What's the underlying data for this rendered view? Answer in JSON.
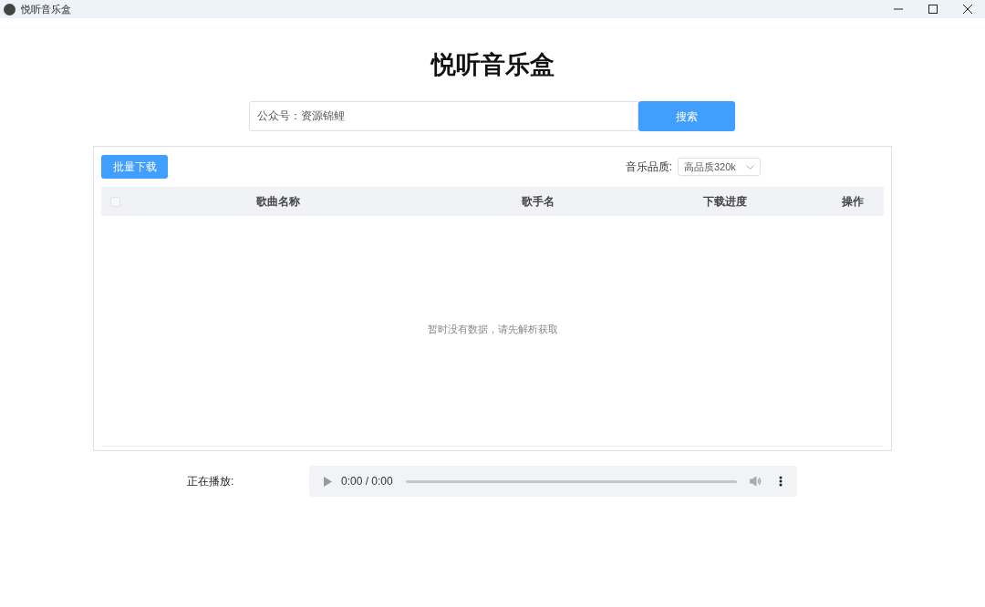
{
  "window": {
    "title": "悦听音乐盒"
  },
  "heading": "悦听音乐盒",
  "search": {
    "value": "公众号：资源锦鲤",
    "button": "搜索"
  },
  "toolbar": {
    "batch_button": "批量下载",
    "quality_label": "音乐品质:",
    "quality_value": "高品质320k"
  },
  "table": {
    "select_all": {
      "checked": false
    },
    "columns": [
      "歌曲名称",
      "歌手名",
      "下载进度",
      "操作"
    ],
    "empty_text": "暂时没有数据，请先解析获取"
  },
  "player": {
    "label": "正在播放:",
    "time": "0:00 / 0:00",
    "level": 0
  }
}
